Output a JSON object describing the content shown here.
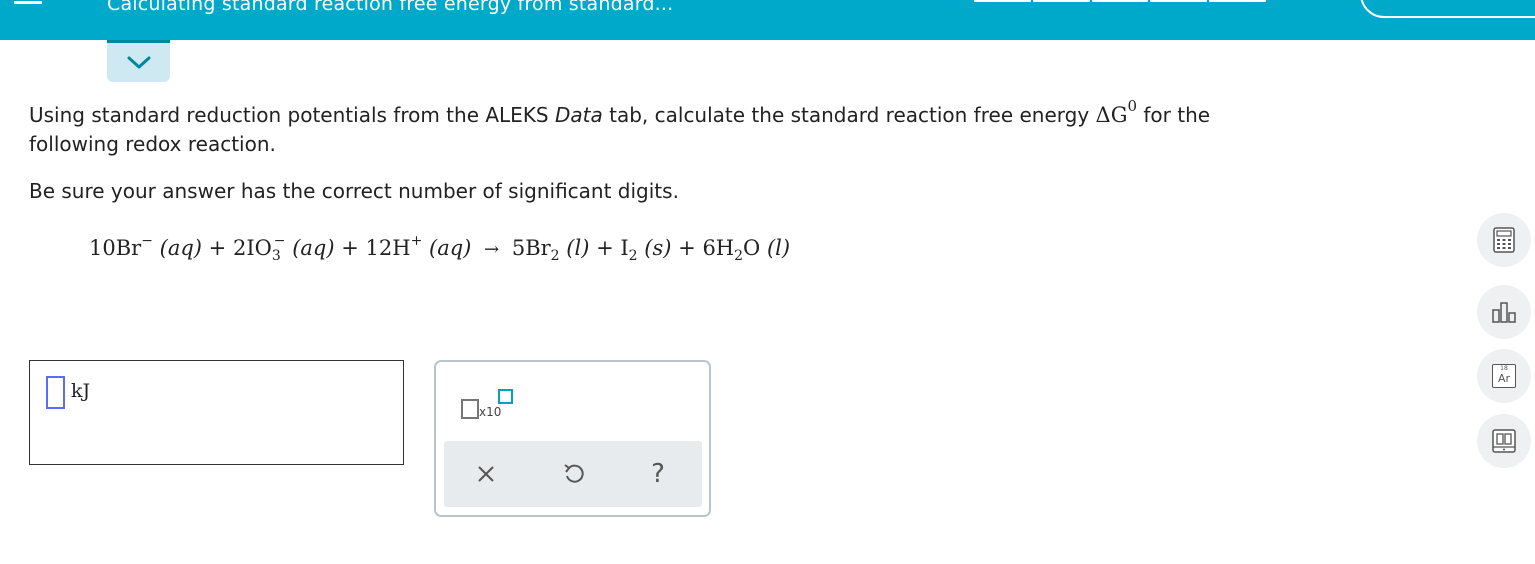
{
  "header": {
    "topic_title": "Calculating standard reaction free energy from standard...",
    "progress_segments": 5
  },
  "question": {
    "line1_before": "Using standard reduction potentials from the ALEKS ",
    "line1_italic": "Data",
    "line1_after": " tab, calculate the standard reaction free energy ",
    "delta_symbol": "ΔG",
    "delta_sup": "0",
    "line1_end": " for the",
    "line2": "following redox reaction.",
    "line3": "Be sure your answer has the correct number of significant digits."
  },
  "equation": {
    "t1_coef": "10Br",
    "t1_charge": "−",
    "t1_phase": "(aq)",
    "plus1": "+",
    "t2_coef": "2IO",
    "t2_sub": "3",
    "t2_charge": "−",
    "t2_phase": "(aq)",
    "plus2": "+",
    "t3_coef": "12H",
    "t3_charge": "+",
    "t3_phase": "(aq)",
    "arrow": "→",
    "p1_coef": "5Br",
    "p1_sub": "2",
    "p1_phase": "(l)",
    "plus3": "+",
    "p2_coef": "I",
    "p2_sub": "2",
    "p2_phase": "(s)",
    "plus4": "+",
    "p3_coef": "6H",
    "p3_sub": "2",
    "p3_tail": "O",
    "p3_phase": "(l)"
  },
  "answer": {
    "value": "",
    "unit": "kJ"
  },
  "toolpad": {
    "sci_label": "x10",
    "clear_icon": "close-icon",
    "undo_icon": "undo-icon",
    "help_label": "?"
  },
  "tools": {
    "calculator_icon": "calculator-icon",
    "chart_icon": "bar-chart-icon",
    "periodic_number": "18",
    "periodic_symbol": "Ar",
    "reference_icon": "book-icon"
  },
  "colors": {
    "header": "#00a9c9",
    "accent": "#00a2bf",
    "input_border": "#5b6bff"
  }
}
